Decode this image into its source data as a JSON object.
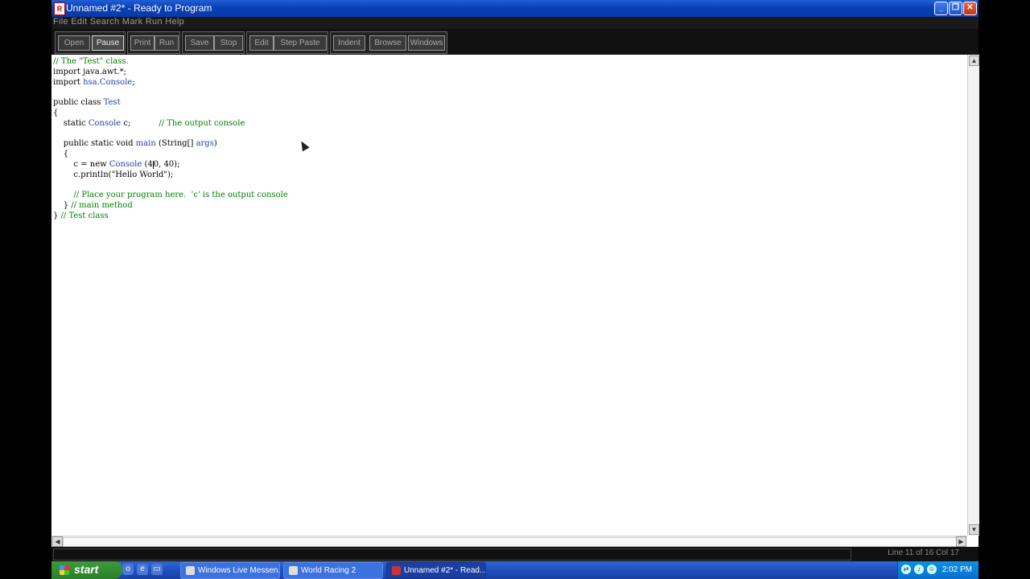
{
  "window": {
    "title": "Unnamed #2* - Ready to Program",
    "icon": "app-icon",
    "controls": {
      "minimize": "_",
      "restore": "❐",
      "close": "✕"
    }
  },
  "menubar": {
    "text": "File  Edit  Search  Mark  Run  Help"
  },
  "toolbar": {
    "groups": [
      {
        "buttons": [
          "Open",
          "Pause"
        ]
      },
      {
        "buttons": [
          "Print",
          "Run"
        ]
      },
      {
        "buttons": [
          "Save",
          "Stop"
        ]
      },
      {
        "buttons": [
          "Edit",
          "Step Paste"
        ]
      },
      {
        "buttons": [
          "Indent",
          "Browse",
          "Windows"
        ]
      }
    ]
  },
  "editor": {
    "lines": [
      [
        {
          "t": "// The \"Test\" class.",
          "c": "cm"
        }
      ],
      [
        {
          "t": "import java.awt.*;",
          "c": "kw"
        }
      ],
      [
        {
          "t": "import ",
          "c": "kw"
        },
        {
          "t": "hsa.Console",
          "c": "ty"
        },
        {
          "t": ";",
          "c": "kw"
        }
      ],
      [],
      [
        {
          "t": "public class ",
          "c": "kw"
        },
        {
          "t": "Test",
          "c": "ty"
        }
      ],
      [
        {
          "t": "{",
          "c": "kw"
        }
      ],
      [
        {
          "t": "    static ",
          "c": "kw"
        },
        {
          "t": "Console",
          "c": "ty"
        },
        {
          "t": " c;           ",
          "c": "kw"
        },
        {
          "t": "// The output console",
          "c": "cm"
        }
      ],
      [],
      [
        {
          "t": "    public static void ",
          "c": "kw"
        },
        {
          "t": "main",
          "c": "ty"
        },
        {
          "t": " (String[] ",
          "c": "kw"
        },
        {
          "t": "args",
          "c": "ty"
        },
        {
          "t": ")",
          "c": "kw"
        }
      ],
      [
        {
          "t": "    {",
          "c": "kw"
        }
      ],
      [
        {
          "t": "        c = new ",
          "c": "kw"
        },
        {
          "t": "Console",
          "c": "ty"
        },
        {
          "t": " (4",
          "c": "kw"
        },
        {
          "t": "|",
          "c": "caret"
        },
        {
          "t": "0, 40);",
          "c": "kw"
        }
      ],
      [
        {
          "t": "        c.println(\"Hello World\");",
          "c": "kw"
        }
      ],
      [],
      [
        {
          "t": "        // Place your program here.  'c' is the output console",
          "c": "cm"
        }
      ],
      [
        {
          "t": "    } ",
          "c": "kw"
        },
        {
          "t": "// main method",
          "c": "cm"
        }
      ],
      [
        {
          "t": "} ",
          "c": "kw"
        },
        {
          "t": "// Test class",
          "c": "cm"
        }
      ]
    ]
  },
  "statusbar": {
    "text": "Line 11 of 16  Col 17"
  },
  "taskbar": {
    "start_label": "start",
    "quick_launch": [
      "outlook-icon",
      "ie-icon",
      "desktop-icon"
    ],
    "tasks": [
      {
        "label": "Windows Live Messen...",
        "icon": "messenger-icon",
        "active": false
      },
      {
        "label": "World Racing 2",
        "icon": "game-icon",
        "active": false
      },
      {
        "label": "Unnamed #2* - Read...",
        "icon": "app-icon",
        "active": true
      }
    ],
    "clock": "2:02 PM"
  },
  "colors": {
    "comment": "#008000",
    "type": "#1f3fa8",
    "titlebar": "#0a3fb8",
    "taskbar": "#1f4fbf"
  }
}
